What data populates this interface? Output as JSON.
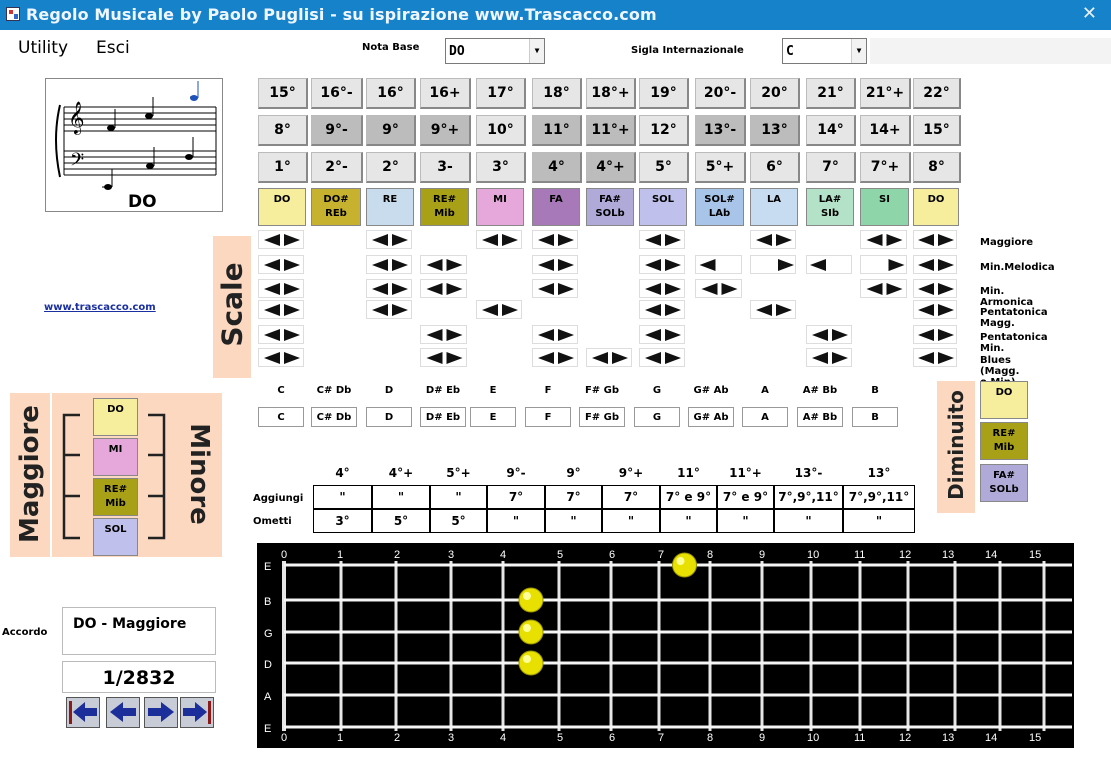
{
  "window": {
    "title": "Regolo Musicale by Paolo Puglisi - su ispirazione www.Trascacco.com",
    "close": "✕"
  },
  "menu": {
    "utility": "Utility",
    "esci": "Esci"
  },
  "nota_base": {
    "label": "Nota Base",
    "value": "DO"
  },
  "sigla": {
    "label": "Sigla Internazionale",
    "value": "C"
  },
  "staff": {
    "note_label": "DO"
  },
  "link": "www.trascacco.com",
  "interval_rows": [
    [
      "15°",
      "16°-",
      "16°",
      "16+",
      "17°",
      "18°",
      "18°+",
      "19°",
      "20°-",
      "20°",
      "21°",
      "21°+",
      "22°"
    ],
    [
      "8°",
      "9°-",
      "9°",
      "9°+",
      "10°",
      "11°",
      "11°+",
      "12°",
      "13°-",
      "13°",
      "14°",
      "14+",
      "15°"
    ],
    [
      "1°",
      "2°-",
      "2°",
      "3-",
      "3°",
      "4°",
      "4°+",
      "5°",
      "5°+",
      "6°",
      "7°",
      "7°+",
      "8°"
    ]
  ],
  "notes": [
    {
      "l1": "DO",
      "l2": "",
      "color": "#f6ee9c"
    },
    {
      "l1": "DO#",
      "l2": "REb",
      "color": "#c6b22f"
    },
    {
      "l1": "RE",
      "l2": "",
      "color": "#c9dcee"
    },
    {
      "l1": "RE#",
      "l2": "Mib",
      "color": "#a8a016"
    },
    {
      "l1": "MI",
      "l2": "",
      "color": "#e6a8da"
    },
    {
      "l1": "FA",
      "l2": "",
      "color": "#a879b8"
    },
    {
      "l1": "FA#",
      "l2": "SOLb",
      "color": "#b0aad9"
    },
    {
      "l1": "SOL",
      "l2": "",
      "color": "#c0c0ec"
    },
    {
      "l1": "SOL#",
      "l2": "LAb",
      "color": "#a8c4e8"
    },
    {
      "l1": "LA",
      "l2": "",
      "color": "#c8dcf1"
    },
    {
      "l1": "LA#",
      "l2": "SIb",
      "color": "#b4e2c8"
    },
    {
      "l1": "SI",
      "l2": "",
      "color": "#8ed6aa"
    },
    {
      "l1": "DO",
      "l2": "",
      "color": "#f6ee9c"
    }
  ],
  "scales": {
    "title": "Scale",
    "names": [
      "Maggiore",
      "Min.Melodica",
      "Min. Armonica",
      "Pentatonica Magg.",
      "Pentatonica Min.",
      "Blues (Magg. o Min)"
    ]
  },
  "note_names": {
    "headers": [
      "C",
      "C# Db",
      "D",
      "D# Eb",
      "E",
      "F",
      "F# Gb",
      "G",
      "G# Ab",
      "A",
      "A# Bb",
      "B"
    ],
    "boxes": [
      "C",
      "C# Db",
      "D",
      "D# Eb",
      "E",
      "F",
      "F# Gb",
      "G",
      "G# Ab",
      "A",
      "A# Bb",
      "B"
    ]
  },
  "chord_table": {
    "headers": [
      "4°",
      "4°+",
      "5°+",
      "9°-",
      "9°",
      "9°+",
      "11°",
      "11°+",
      "13°-",
      "13°"
    ],
    "row_labels": [
      "Aggiungi",
      "Ometti"
    ],
    "aggiungi": [
      "\"",
      "\"",
      "\"",
      "7°",
      "7°",
      "7°",
      "7° e 9°",
      "7° e 9°",
      "7°,9°,11°",
      "7°,9°,11°"
    ],
    "ometti": [
      "3°",
      "5°",
      "5°",
      "\"",
      "\"",
      "\"",
      "\"",
      "\"",
      "\"",
      "\""
    ]
  },
  "maggiore_minore": {
    "left": "Maggiore",
    "right": "Minore",
    "notes": [
      {
        "l1": "DO",
        "l2": "",
        "color": "#f6ee9c"
      },
      {
        "l1": "MI",
        "l2": "",
        "color": "#e6a8da"
      },
      {
        "l1": "RE#",
        "l2": "Mib",
        "color": "#a8a016"
      },
      {
        "l1": "SOL",
        "l2": "",
        "color": "#c0c0ec"
      }
    ]
  },
  "diminuito": {
    "label": "Diminuito",
    "notes": [
      {
        "l1": "DO",
        "l2": "",
        "color": "#f6ee9c"
      },
      {
        "l1": "RE#",
        "l2": "Mib",
        "color": "#a8a016"
      },
      {
        "l1": "FA#",
        "l2": "SOLb",
        "color": "#b0aad9"
      }
    ]
  },
  "accordo": {
    "label": "Accordo",
    "value": "DO - Maggiore",
    "counter": "1/2832"
  },
  "fretboard": {
    "frets": [
      "0",
      "1",
      "2",
      "3",
      "4",
      "5",
      "6",
      "7",
      "8",
      "9",
      "10",
      "11",
      "12",
      "13",
      "14",
      "15"
    ],
    "strings": [
      "E",
      "B",
      "G",
      "D",
      "A",
      "E"
    ],
    "dots": [
      {
        "string": 0,
        "fret": 8
      },
      {
        "string": 1,
        "fret": 5
      },
      {
        "string": 2,
        "fret": 5
      },
      {
        "string": 3,
        "fret": 5
      }
    ]
  }
}
